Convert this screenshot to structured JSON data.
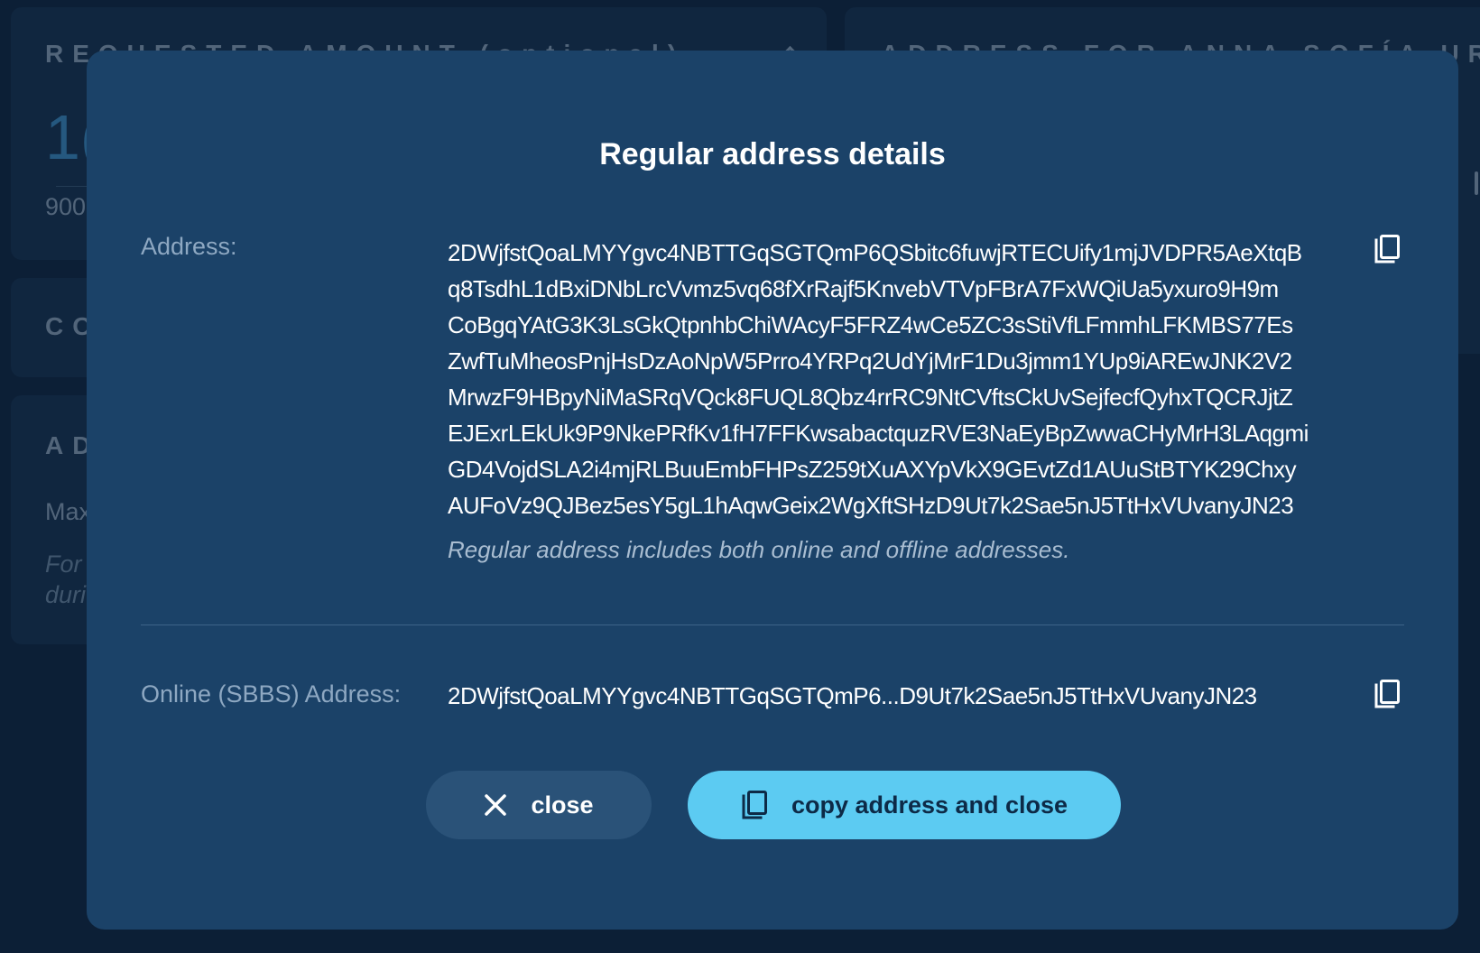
{
  "background": {
    "requested_amount_label": "REQUESTED AMOUNT (optional)",
    "address_for_label": "ADDRESS FOR ANNA SOFÍA UREÑA R",
    "amount_value_partial": "1(",
    "secondary_value_partial": "900",
    "card3_label_partial": "CO",
    "card4_label_partial": "AD",
    "card4_text_partial": "Max",
    "card4_italic_1_partial": "For",
    "card4_italic_2_partial": "duri"
  },
  "modal": {
    "title": "Regular address details",
    "address_label": "Address:",
    "address_lines": [
      "2DWjfstQoaLMYYgvc4NBTTGqSGTQmP6QSbitc6fuwjRTECUify1mjJVDPR5AeXtqB",
      "q8TsdhL1dBxiDNbLrcVvmz5vq68fXrRajf5KnvebVTVpFBrA7FxWQiUa5yxuro9H9m",
      "CoBgqYAtG3K3LsGkQtpnhbChiWAcyF5FRZ4wCe5ZC3sStiVfLFmmhLFKMBS77Es",
      "ZwfTuMheosPnjHsDzAoNpW5Prro4YRPq2UdYjMrF1Du3jmm1YUp9iAREwJNK2V2",
      "MrwzF9HBpyNiMaSRqVQck8FUQL8Qbz4rrRC9NtCVftsCkUvSejfecfQyhxTQCRJjtZ",
      "EJExrLEkUk9P9NkePRfKv1fH7FFKwsabactquzRVE3NaEyBpZwwaCHyMrH3LAqgmi",
      "GD4VojdSLA2i4mjRLBuuEmbFHPsZ259tXuAXYpVkX9GEvtZd1AUuStBTYK29Chxy",
      "AUFoVz9QJBez5esY5gL1hAqwGeix2WgXftSHzD9Ut7k2Sae5nJ5TtHxVUvanyJN23"
    ],
    "address_note": "Regular address includes both online and offline addresses.",
    "online_label": "Online (SBBS) Address:",
    "online_address": "2DWjfstQoaLMYYgvc4NBTTGqSGTQmP6...D9Ut7k2Sae5nJ5TtHxVUvanyJN23",
    "close_label": "close",
    "copy_close_label": "copy address and close"
  },
  "icons": {
    "copy": "copy-icon",
    "close": "close-icon"
  },
  "colors": {
    "modal_bg": "#1b4268",
    "page_bg": "#0f2743",
    "accent": "#5ccbf2",
    "secondary_button": "#2a5278"
  }
}
